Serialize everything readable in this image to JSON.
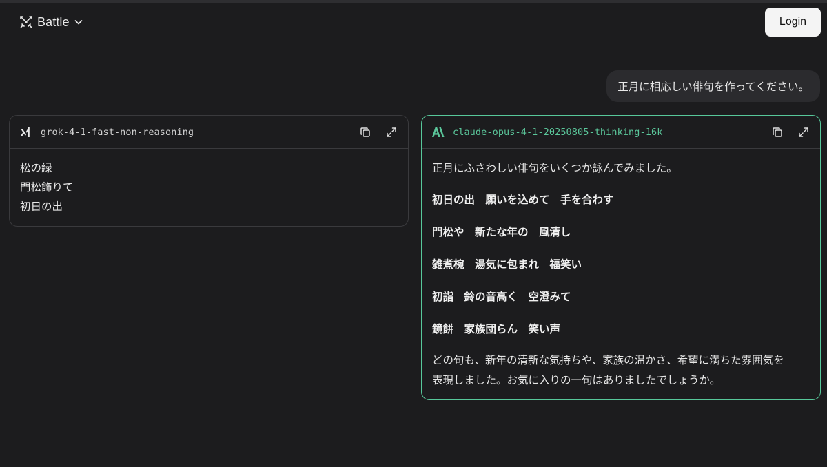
{
  "header": {
    "mode_label": "Battle",
    "login_label": "Login"
  },
  "user_message": "正月に相応しい俳句を作ってください。",
  "responses": [
    {
      "model": "grok-4-1-fast-non-reasoning",
      "lines": [
        "松の緑",
        "門松飾りて",
        "初日の出"
      ]
    },
    {
      "model": "claude-opus-4-1-20250805-thinking-16k",
      "intro": "正月にふさわしい俳句をいくつか詠んでみました。",
      "haiku": [
        "初日の出　願いを込めて　手を合わす",
        "門松や　新たな年の　風清し",
        "雑煮椀　湯気に包まれ　福笑い",
        "初詣　鈴の音高く　空澄みて",
        "鏡餅　家族団らん　笑い声"
      ],
      "closing_1": "どの句も、新年の清新な気持ちや、家族の温かさ、希望に満ちた雰囲気を",
      "closing_2": "表現しました。お気に入りの一句はありましたでしょうか。"
    }
  ],
  "colors": {
    "background": "#1c1c1e",
    "accent": "#57c79a",
    "bubble": "#2b2b2e"
  }
}
